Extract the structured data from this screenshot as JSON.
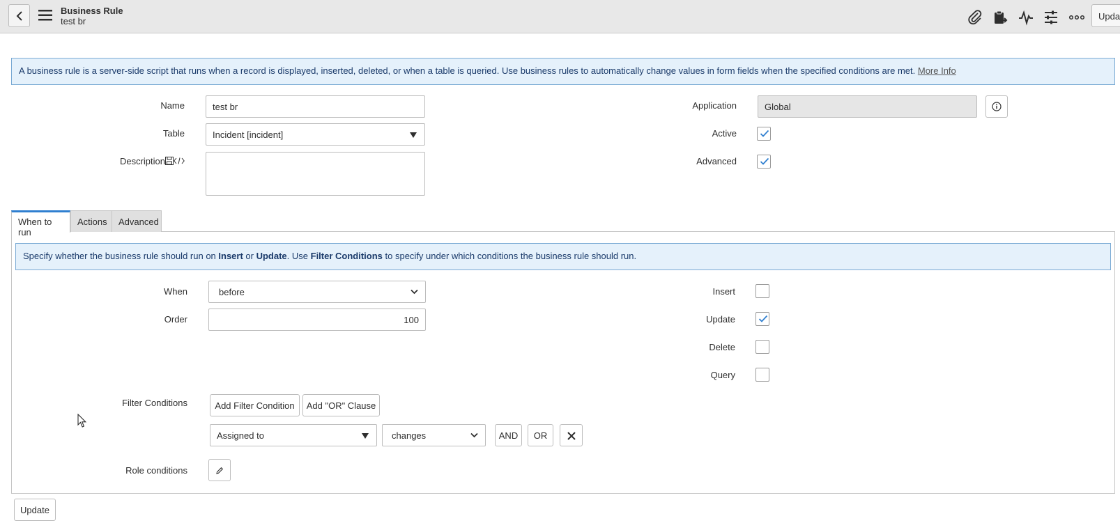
{
  "header": {
    "title": "Business Rule",
    "subtitle": "test br",
    "update_label": "Update",
    "icons": [
      "paperclip-icon",
      "clipboard-icon",
      "activity-icon",
      "sliders-icon",
      "more-icon"
    ]
  },
  "info_banner": {
    "text": "A business rule is a server-side script that runs when a record is displayed, inserted, deleted, or when a table is queried. Use business rules to automatically change values in form fields when the specified conditions are met.",
    "link": "More Info"
  },
  "form": {
    "name_label": "Name",
    "name_value": "test br",
    "table_label": "Table",
    "table_value": "Incident [incident]",
    "description_label": "Description",
    "description_value": "",
    "application_label": "Application",
    "application_value": "Global",
    "active_label": "Active",
    "active_checked": true,
    "advanced_label": "Advanced",
    "advanced_checked": true
  },
  "tabs": [
    {
      "label": "When to run",
      "active": true
    },
    {
      "label": "Actions",
      "active": false
    },
    {
      "label": "Advanced",
      "active": false
    }
  ],
  "when_to_run": {
    "banner": {
      "p1": "Specify whether the business rule should run on ",
      "insert": "Insert",
      "p2": " or ",
      "update": "Update",
      "p3": ". Use ",
      "filter": "Filter Conditions",
      "p4": " to specify under which conditions the business rule should run."
    },
    "when_label": "When",
    "when_value": "before",
    "order_label": "Order",
    "order_value": "100",
    "insert_label": "Insert",
    "insert_checked": false,
    "update_label": "Update",
    "update_checked": true,
    "delete_label": "Delete",
    "delete_checked": false,
    "query_label": "Query",
    "query_checked": false,
    "filter_conditions_label": "Filter Conditions",
    "add_filter_condition": "Add Filter Condition",
    "add_or_clause": "Add \"OR\" Clause",
    "condition_field": "Assigned to",
    "condition_operator": "changes",
    "and_label": "AND",
    "or_label": "OR",
    "role_conditions_label": "Role conditions"
  },
  "footer": {
    "update_label": "Update"
  }
}
